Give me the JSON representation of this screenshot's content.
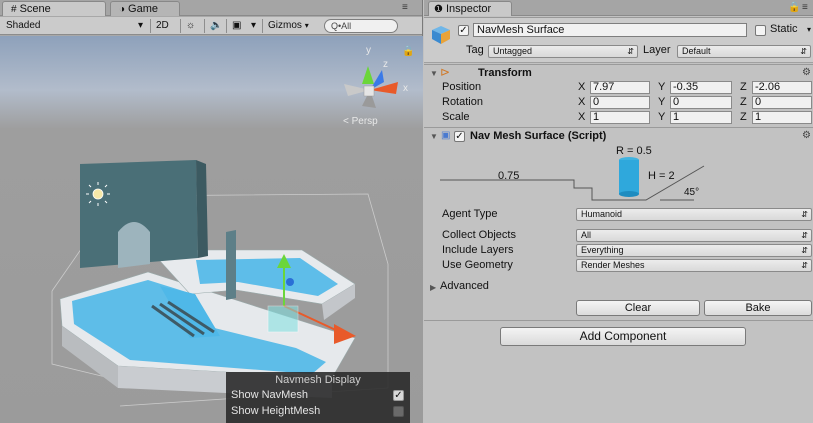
{
  "scene": {
    "tabs": [
      {
        "label": "Scene",
        "icon": "hash-icon"
      },
      {
        "label": "Game",
        "icon": "pacman-icon"
      }
    ],
    "toolbar": {
      "shading_mode": "Shaded",
      "mode_2d": "2D",
      "gizmos": "Gizmos",
      "search_placeholder": "Q•All"
    },
    "persp_label": "< Persp",
    "gizmo_axes": {
      "x": "x",
      "y": "y",
      "z": "z"
    },
    "navmesh_display": {
      "title": "Navmesh Display",
      "show_navmesh": {
        "label": "Show NavMesh",
        "checked": true
      },
      "show_heightmesh": {
        "label": "Show HeightMesh",
        "checked": false
      }
    }
  },
  "inspector": {
    "tab_label": "Inspector",
    "object": {
      "active": true,
      "name": "NavMesh Surface",
      "static_label": "Static",
      "tag_label": "Tag",
      "tag_value": "Untagged",
      "layer_label": "Layer",
      "layer_value": "Default"
    },
    "transform": {
      "title": "Transform",
      "rows": [
        {
          "label": "Position",
          "x": "7.97",
          "y": "-0.35",
          "z": "-2.06"
        },
        {
          "label": "Rotation",
          "x": "0",
          "y": "0",
          "z": "0"
        },
        {
          "label": "Scale",
          "x": "1",
          "y": "1",
          "z": "1"
        }
      ]
    },
    "navmesh_surface": {
      "title": "Nav Mesh Surface (Script)",
      "enabled": true,
      "diagram": {
        "radius": "R = 0.5",
        "step": "0.75",
        "height": "H = 2",
        "slope": "45°"
      },
      "agent_type_label": "Agent Type",
      "agent_type_value": "Humanoid",
      "collect_objects_label": "Collect Objects",
      "collect_objects_value": "All",
      "include_layers_label": "Include Layers",
      "include_layers_value": "Everything",
      "use_geometry_label": "Use Geometry",
      "use_geometry_value": "Render Meshes",
      "advanced_label": "Advanced",
      "clear_label": "Clear",
      "bake_label": "Bake"
    },
    "add_component_label": "Add Component"
  },
  "colors": {
    "navmesh": "#4fb8e8",
    "wall": "#4a6f77",
    "floor": "#e9ecef",
    "panel_bg": "#c2c2c2"
  }
}
